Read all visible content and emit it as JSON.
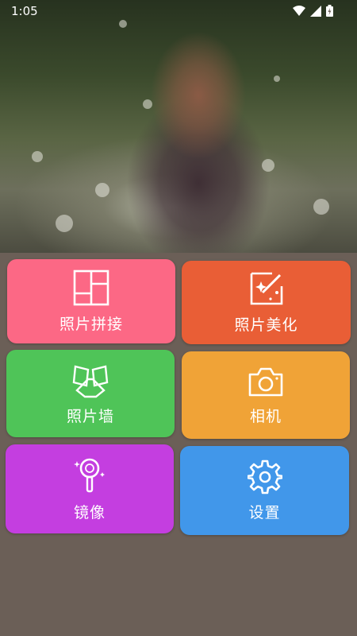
{
  "status_bar": {
    "time": "1:05"
  },
  "tiles": [
    {
      "label": "照片拼接",
      "color": "#fc6885",
      "icon": "collage-layout-icon"
    },
    {
      "label": "照片美化",
      "color": "#e95e36",
      "icon": "magic-wand-photo-icon"
    },
    {
      "label": "照片墙",
      "color": "#4fc458",
      "icon": "photo-wall-icon"
    },
    {
      "label": "相机",
      "color": "#f0a337",
      "icon": "camera-icon"
    },
    {
      "label": "镜像",
      "color": "#c43ee0",
      "icon": "mirror-icon"
    },
    {
      "label": "设置",
      "color": "#4197ea",
      "icon": "gear-icon"
    }
  ]
}
